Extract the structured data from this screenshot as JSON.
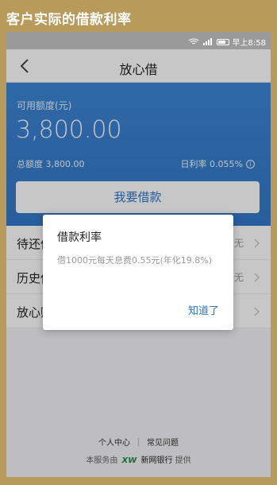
{
  "caption": "客户实际的借款利率",
  "status_bar": {
    "time": "早上8:58",
    "icons": [
      "wifi-icon",
      "signal-icon",
      "battery-icon"
    ]
  },
  "nav": {
    "title": "放心借",
    "back_icon": "chevron-left-icon"
  },
  "hero": {
    "available_label": "可用额度(元)",
    "available_amount": "3,800.00",
    "total_label": "总额度  3,800.00",
    "rate_label": "日利率  0.055%",
    "info_icon": "info-icon",
    "borrow_button": "我要借款",
    "background_color": "#3a80d0"
  },
  "list": [
    {
      "label": "待还借",
      "value": "无"
    },
    {
      "label": "历史借",
      "value": "无"
    },
    {
      "label": "放心购",
      "value": ""
    }
  ],
  "dialog": {
    "title": "借款利率",
    "body": "借1000元每天息费0.55元(年化19.8%)",
    "ok": "知道了"
  },
  "footer": {
    "link_personal": "个人中心",
    "link_faq": "常见问题",
    "provider_prefix": "本服务由",
    "provider_logo": "XW",
    "provider_bank": "新网银行",
    "provider_suffix": "提供"
  },
  "colors": {
    "accent": "#2f74c4",
    "caption_band": "#b89a5a"
  }
}
